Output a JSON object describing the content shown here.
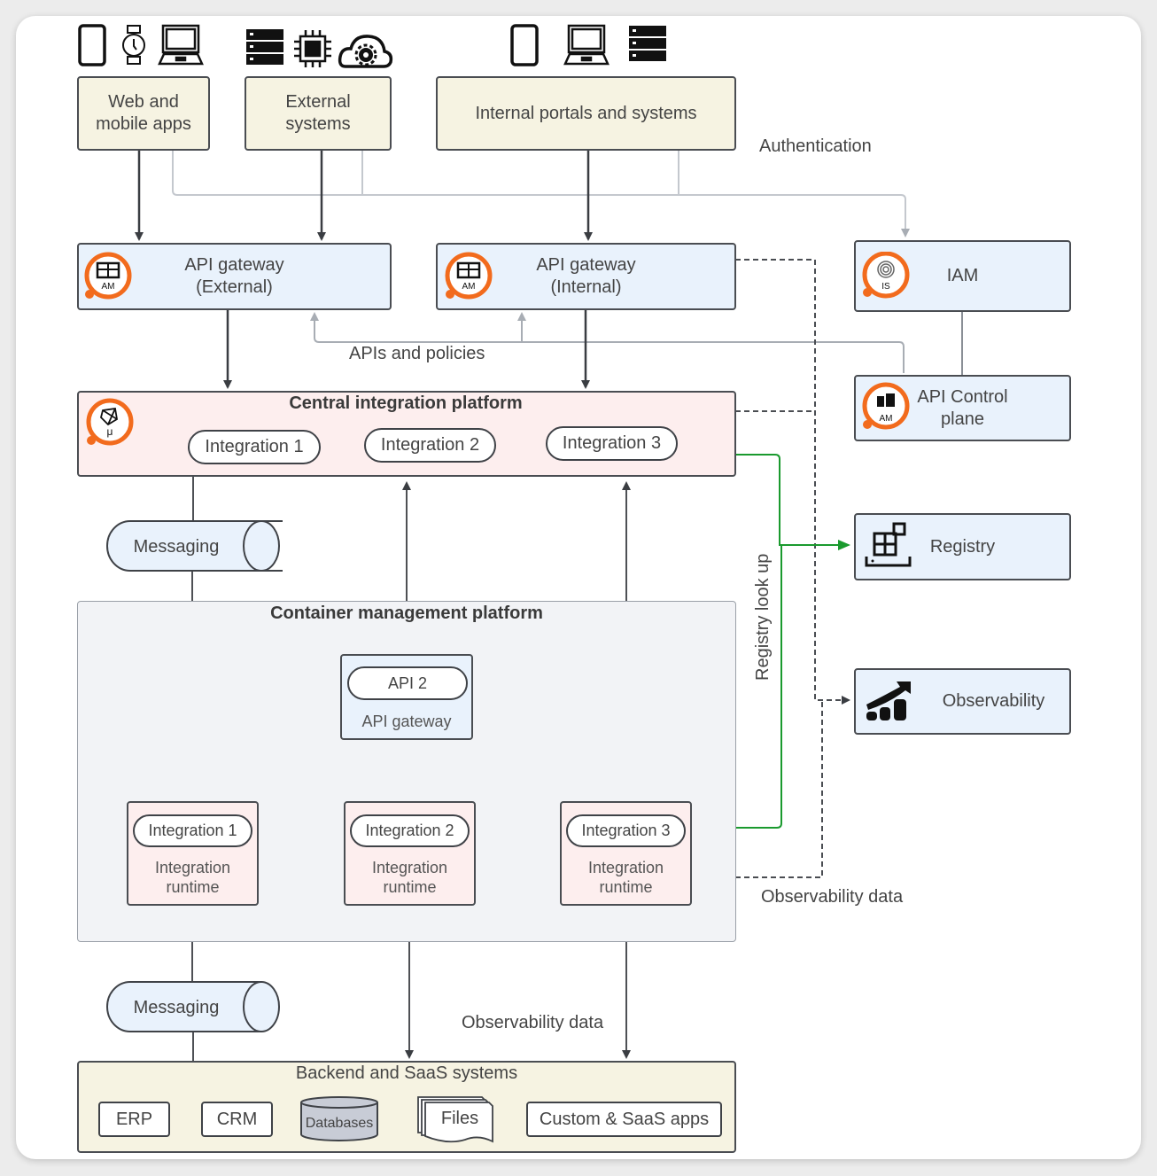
{
  "clients": {
    "web_mobile": "Web and mobile apps",
    "external": "External systems",
    "internal": "Internal portals and systems",
    "web_icons": [
      "mobile-phone-icon",
      "smartwatch-icon",
      "laptop-icon"
    ],
    "external_icons": [
      "server-icon",
      "chip-icon",
      "cloud-gear-icon"
    ],
    "internal_icons": [
      "mobile-phone-icon",
      "laptop-icon",
      "server-icon"
    ]
  },
  "labels": {
    "authentication": "Authentication",
    "apis_policies": "APIs and policies",
    "registry_lookup": "Registry look up",
    "observability_data_right": "Observability data",
    "observability_data_bottom": "Observability data"
  },
  "gateways": {
    "external": {
      "line1": "API gateway",
      "line2": "(External)",
      "badge": "AM"
    },
    "internal": {
      "line1": "API gateway",
      "line2": "(Internal)",
      "badge": "AM"
    }
  },
  "right": {
    "iam": {
      "label": "IAM",
      "badge": "IS"
    },
    "control_plane": {
      "line1": "API Control",
      "line2": "plane",
      "badge": "AM"
    },
    "registry": "Registry",
    "observability": "Observability"
  },
  "central": {
    "title": "Central integration platform",
    "badge": "μ",
    "integrations": [
      "Integration 1",
      "Integration 2",
      "Integration 3"
    ]
  },
  "messaging": {
    "top": "Messaging",
    "bottom": "Messaging"
  },
  "container": {
    "title": "Container management platform",
    "api_pill": "API 2",
    "api_gateway": "API gateway",
    "runtimes": [
      {
        "pill": "Integration 1",
        "line1": "Integration",
        "line2": "runtime"
      },
      {
        "pill": "Integration 2",
        "line1": "Integration",
        "line2": "runtime"
      },
      {
        "pill": "Integration 3",
        "line1": "Integration",
        "line2": "runtime"
      }
    ]
  },
  "backend": {
    "title": "Backend and SaaS systems",
    "erp": "ERP",
    "crm": "CRM",
    "databases": "Databases",
    "files": "Files",
    "custom": "Custom & SaaS apps"
  },
  "colors": {
    "accent_orange": "#f26b1d",
    "registry_green": "#1a9a2e",
    "box_beige": "#f6f3e2",
    "box_blue": "#e9f2fc",
    "box_pink": "#fdeeee"
  }
}
